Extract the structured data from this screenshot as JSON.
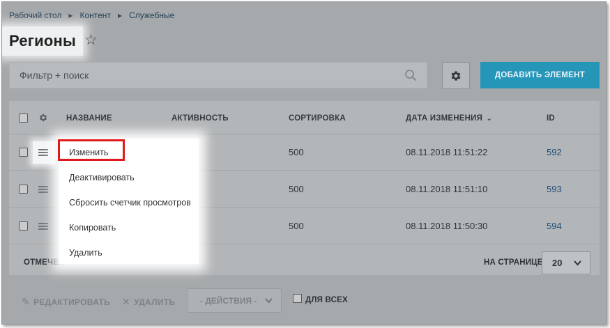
{
  "breadcrumbs": [
    "Рабочий стол",
    "Контент",
    "Служебные"
  ],
  "page": {
    "title": "Регионы"
  },
  "filter": {
    "placeholder": "Фильтр + поиск"
  },
  "toolbar": {
    "add_label": "ДОБАВИТЬ ЭЛЕМЕНТ"
  },
  "table": {
    "headers": {
      "name": "НАЗВАНИЕ",
      "active": "АКТИВНОСТЬ",
      "sort": "СОРТИРОВКА",
      "date": "ДАТА ИЗМЕНЕНИЯ",
      "id": "ID"
    },
    "rows": [
      {
        "sort": "500",
        "date": "08.11.2018 11:51:22",
        "id": "592"
      },
      {
        "sort": "500",
        "date": "08.11.2018 11:51:10",
        "id": "593"
      },
      {
        "sort": "500",
        "date": "08.11.2018 11:50:30",
        "id": "594"
      }
    ]
  },
  "footer": {
    "selected_label": "ОТМЕЧЕН",
    "per_page_label": "НА СТРАНИЦЕ:",
    "per_page_value": "20"
  },
  "action_bar": {
    "edit_label": "РЕДАКТИРОВАТЬ",
    "delete_label": "УДАЛИТЬ",
    "actions_label": "- ДЕЙСТВИЯ -",
    "for_all_label": "ДЛЯ ВСЕХ"
  },
  "context_menu": {
    "items": [
      "Изменить",
      "Деактивировать",
      "Сбросить счетчик просмотров",
      "Копировать",
      "Удалить"
    ]
  },
  "colors": {
    "accent": "#2595b8",
    "highlight": "#e0191e",
    "link": "#1f4c7a"
  }
}
